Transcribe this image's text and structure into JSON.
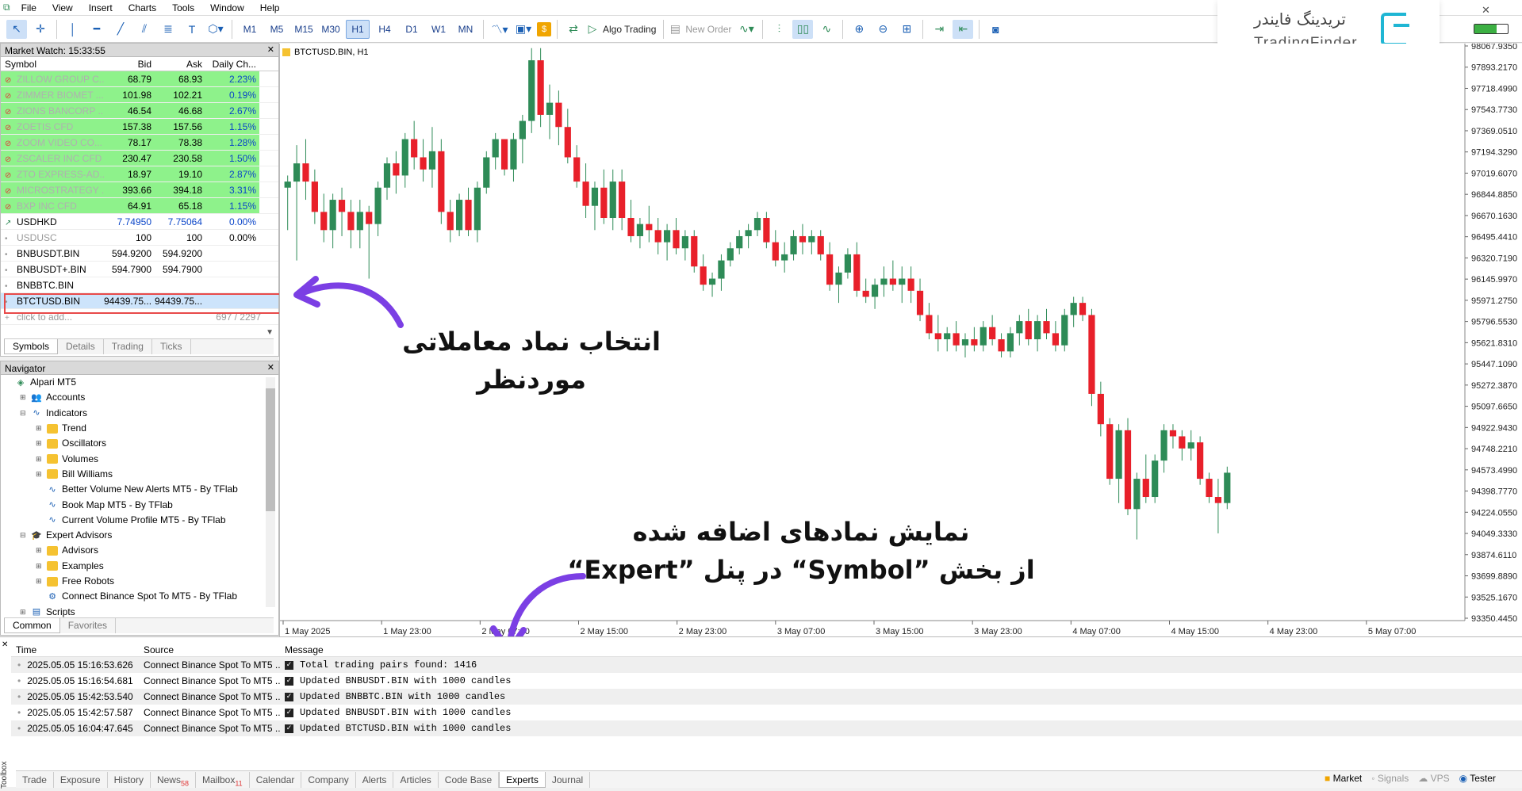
{
  "menu": [
    "File",
    "View",
    "Insert",
    "Charts",
    "Tools",
    "Window",
    "Help"
  ],
  "toolbar": {
    "timeframes": [
      "M1",
      "M5",
      "M15",
      "M30",
      "H1",
      "H4",
      "D1",
      "W1",
      "MN"
    ],
    "active_timeframe": "H1",
    "algo_trading": "Algo Trading",
    "new_order": "New Order"
  },
  "logo": {
    "farsi": "تریدینگ فایندر",
    "latin": "TradingFinder"
  },
  "market_watch": {
    "title": "Market Watch: 15:33:55",
    "headers": [
      "Symbol",
      "Bid",
      "Ask",
      "Daily Ch..."
    ],
    "rows": [
      {
        "symbol": "ZILLOW GROUP C...",
        "bid": "68.79",
        "ask": "68.93",
        "change": "2.23%",
        "style": "green",
        "dot": "red"
      },
      {
        "symbol": "ZIMMER BIOMET ...",
        "bid": "101.98",
        "ask": "102.21",
        "change": "0.19%",
        "style": "green",
        "dot": "red"
      },
      {
        "symbol": "ZIONS BANCORP ...",
        "bid": "46.54",
        "ask": "46.68",
        "change": "2.67%",
        "style": "green",
        "dot": "red"
      },
      {
        "symbol": "ZOETIS CFD",
        "bid": "157.38",
        "ask": "157.56",
        "change": "1.15%",
        "style": "green",
        "dot": "red"
      },
      {
        "symbol": "ZOOM VIDEO CO...",
        "bid": "78.17",
        "ask": "78.38",
        "change": "1.28%",
        "style": "green",
        "dot": "red"
      },
      {
        "symbol": "ZSCALER INC CFD",
        "bid": "230.47",
        "ask": "230.58",
        "change": "1.50%",
        "style": "green",
        "dot": "red"
      },
      {
        "symbol": "ZTO EXPRESS-AD...",
        "bid": "18.97",
        "ask": "19.10",
        "change": "2.87%",
        "style": "green",
        "dot": "red"
      },
      {
        "symbol": "MICROSTRATEGY ...",
        "bid": "393.66",
        "ask": "394.18",
        "change": "3.31%",
        "style": "green",
        "dot": "red"
      },
      {
        "symbol": "BXP INC CFD",
        "bid": "64.91",
        "ask": "65.18",
        "change": "1.15%",
        "style": "green",
        "dot": "red"
      },
      {
        "symbol": "USDHKD",
        "bid": "7.74950",
        "ask": "7.75064",
        "change": "0.00%",
        "style": "blue",
        "dot": "grn"
      },
      {
        "symbol": "USDUSC",
        "bid": "100",
        "ask": "100",
        "change": "0.00%",
        "style": "dim",
        "dot": "gray"
      },
      {
        "symbol": "BNBUSDT.BIN",
        "bid": "594.9200",
        "ask": "594.9200",
        "change": "",
        "style": "",
        "dot": "gray"
      },
      {
        "symbol": "BNBUSDT+.BIN",
        "bid": "594.7900",
        "ask": "594.7900",
        "change": "",
        "style": "",
        "dot": "gray"
      },
      {
        "symbol": "BNBBTC.BIN",
        "bid": "",
        "ask": "",
        "change": "",
        "style": "",
        "dot": "gray"
      },
      {
        "symbol": "BTCTUSD.BIN",
        "bid": "94439.75...",
        "ask": "94439.75...",
        "change": "",
        "style": "sel",
        "dot": "gray"
      }
    ],
    "add_placeholder": "click to add...",
    "count": "697 / 2297",
    "tabs": [
      "Symbols",
      "Details",
      "Trading",
      "Ticks"
    ]
  },
  "navigator": {
    "title": "Navigator",
    "items": [
      {
        "label": "Alpari MT5",
        "level": 0,
        "icon": "broker-icon",
        "pm": ""
      },
      {
        "label": "Accounts",
        "level": 1,
        "icon": "accounts-icon",
        "pm": "+"
      },
      {
        "label": "Indicators",
        "level": 1,
        "icon": "indicators-icon",
        "pm": "-"
      },
      {
        "label": "Trend",
        "level": 2,
        "icon": "folder-icon",
        "pm": "+"
      },
      {
        "label": "Oscillators",
        "level": 2,
        "icon": "folder-icon",
        "pm": "+"
      },
      {
        "label": "Volumes",
        "level": 2,
        "icon": "folder-icon",
        "pm": "+"
      },
      {
        "label": "Bill Williams",
        "level": 2,
        "icon": "folder-icon",
        "pm": "+"
      },
      {
        "label": "Better Volume New Alerts MT5 - By TFlab",
        "level": 2,
        "icon": "indicator-icon",
        "pm": ""
      },
      {
        "label": "Book Map MT5 - By TFlab",
        "level": 2,
        "icon": "indicator-icon",
        "pm": ""
      },
      {
        "label": "Current Volume Profile MT5 - By TFlab",
        "level": 2,
        "icon": "indicator-icon",
        "pm": ""
      },
      {
        "label": "Expert Advisors",
        "level": 1,
        "icon": "experts-icon",
        "pm": "-"
      },
      {
        "label": "Advisors",
        "level": 2,
        "icon": "folder-icon",
        "pm": "+"
      },
      {
        "label": "Examples",
        "level": 2,
        "icon": "folder-icon",
        "pm": "+"
      },
      {
        "label": "Free Robots",
        "level": 2,
        "icon": "folder-icon",
        "pm": "+"
      },
      {
        "label": "Connect Binance Spot To MT5 - By TFlab",
        "level": 2,
        "icon": "expert-icon",
        "pm": ""
      },
      {
        "label": "Scripts",
        "level": 1,
        "icon": "scripts-icon",
        "pm": "+"
      }
    ],
    "tabs": [
      "Common",
      "Favorites"
    ]
  },
  "chart": {
    "title": "BTCTUSD.BIN, H1",
    "price_labels": [
      "98067.9350",
      "97893.2170",
      "97718.4990",
      "97543.7730",
      "97369.0510",
      "97194.3290",
      "97019.6070",
      "96844.8850",
      "96670.1630",
      "96495.4410",
      "96320.7190",
      "96145.9970",
      "95971.2750",
      "95796.5530",
      "95621.8310",
      "95447.1090",
      "95272.3870",
      "95097.6650",
      "94922.9430",
      "94748.2210",
      "94573.4990",
      "94398.7770",
      "94224.0550",
      "94049.3330",
      "93874.6110",
      "93699.8890",
      "93525.1670",
      "93350.4450"
    ],
    "time_labels": [
      "1 May 2025",
      "1 May 23:00",
      "2 May 07:00",
      "2 May 15:00",
      "2 May 23:00",
      "3 May 07:00",
      "3 May 15:00",
      "3 May 23:00",
      "4 May 07:00",
      "4 May 15:00",
      "4 May 23:00",
      "5 May 07:00"
    ],
    "colors": {
      "bull": "#2e8b57",
      "bear": "#e8202a",
      "wick": "#2e8b57"
    }
  },
  "chart_data": {
    "type": "candlestick",
    "title": "BTCTUSD.BIN, H1",
    "y_min": 93350.445,
    "y_max": 98067.935,
    "candles": [
      [
        96900,
        97000,
        96550,
        96950
      ],
      [
        96950,
        97250,
        96300,
        97100
      ],
      [
        97100,
        97300,
        96800,
        96950
      ],
      [
        96950,
        97050,
        96600,
        96700
      ],
      [
        96700,
        96850,
        96450,
        96550
      ],
      [
        96550,
        96850,
        96400,
        96800
      ],
      [
        96800,
        96900,
        96500,
        96700
      ],
      [
        96700,
        96800,
        96400,
        96550
      ],
      [
        96550,
        96800,
        96400,
        96700
      ],
      [
        96700,
        96750,
        96150,
        96600
      ],
      [
        96600,
        96950,
        96500,
        96900
      ],
      [
        96900,
        97150,
        96800,
        97100
      ],
      [
        97100,
        97200,
        96850,
        97000
      ],
      [
        97000,
        97350,
        96900,
        97300
      ],
      [
        97300,
        97450,
        97050,
        97150
      ],
      [
        97150,
        97300,
        96950,
        97050
      ],
      [
        97050,
        97400,
        96900,
        97200
      ],
      [
        97200,
        97300,
        96600,
        96700
      ],
      [
        96700,
        96800,
        96450,
        96550
      ],
      [
        96550,
        96850,
        96500,
        96800
      ],
      [
        96800,
        96900,
        96500,
        96550
      ],
      [
        96550,
        96950,
        96450,
        96900
      ],
      [
        96900,
        97200,
        96850,
        97150
      ],
      [
        97150,
        97350,
        97050,
        97300
      ],
      [
        97300,
        97300,
        97000,
        97050
      ],
      [
        97050,
        97350,
        96950,
        97300
      ],
      [
        97300,
        97500,
        97100,
        97450
      ],
      [
        97450,
        98050,
        97350,
        97950
      ],
      [
        97950,
        98050,
        97400,
        97500
      ],
      [
        97500,
        97750,
        97300,
        97600
      ],
      [
        97600,
        97700,
        97250,
        97400
      ],
      [
        97400,
        97550,
        97100,
        97150
      ],
      [
        97150,
        97250,
        96900,
        96950
      ],
      [
        96950,
        97100,
        96650,
        96750
      ],
      [
        96750,
        96950,
        96550,
        96900
      ],
      [
        96900,
        97050,
        96600,
        96650
      ],
      [
        96650,
        97050,
        96550,
        96950
      ],
      [
        96950,
        97050,
        96550,
        96650
      ],
      [
        96650,
        96800,
        96450,
        96500
      ],
      [
        96500,
        96650,
        96400,
        96600
      ],
      [
        96600,
        96750,
        96450,
        96550
      ],
      [
        96550,
        96650,
        96350,
        96450
      ],
      [
        96450,
        96600,
        96300,
        96550
      ],
      [
        96550,
        96650,
        96350,
        96400
      ],
      [
        96400,
        96550,
        96300,
        96500
      ],
      [
        96500,
        96550,
        96200,
        96250
      ],
      [
        96250,
        96350,
        96050,
        96100
      ],
      [
        96100,
        96200,
        96000,
        96150
      ],
      [
        96150,
        96350,
        96050,
        96300
      ],
      [
        96300,
        96450,
        96250,
        96400
      ],
      [
        96400,
        96550,
        96350,
        96500
      ],
      [
        96500,
        96600,
        96400,
        96550
      ],
      [
        96550,
        96700,
        96500,
        96650
      ],
      [
        96650,
        96700,
        96400,
        96450
      ],
      [
        96450,
        96550,
        96250,
        96300
      ],
      [
        96300,
        96450,
        96200,
        96350
      ],
      [
        96350,
        96550,
        96300,
        96500
      ],
      [
        96500,
        96600,
        96350,
        96450
      ],
      [
        96450,
        96550,
        96350,
        96500
      ],
      [
        96500,
        96550,
        96300,
        96350
      ],
      [
        96350,
        96450,
        96050,
        96100
      ],
      [
        96100,
        96250,
        95950,
        96200
      ],
      [
        96200,
        96400,
        96150,
        96350
      ],
      [
        96350,
        96450,
        96000,
        96050
      ],
      [
        96050,
        96150,
        95950,
        96000
      ],
      [
        96000,
        96150,
        95900,
        96100
      ],
      [
        96100,
        96250,
        96000,
        96150
      ],
      [
        96150,
        96300,
        96050,
        96100
      ],
      [
        96100,
        96250,
        95950,
        96150
      ],
      [
        96150,
        96250,
        95950,
        96050
      ],
      [
        96050,
        96150,
        95800,
        95850
      ],
      [
        95850,
        95950,
        95650,
        95700
      ],
      [
        95700,
        95850,
        95550,
        95650
      ],
      [
        95650,
        95750,
        95550,
        95700
      ],
      [
        95700,
        95800,
        95550,
        95600
      ],
      [
        95600,
        95700,
        95500,
        95650
      ],
      [
        95650,
        95750,
        95550,
        95600
      ],
      [
        95600,
        95800,
        95550,
        95750
      ],
      [
        95750,
        95850,
        95600,
        95650
      ],
      [
        95650,
        95700,
        95500,
        95550
      ],
      [
        95550,
        95750,
        95500,
        95700
      ],
      [
        95700,
        95850,
        95600,
        95800
      ],
      [
        95800,
        95900,
        95600,
        95650
      ],
      [
        95650,
        95850,
        95550,
        95800
      ],
      [
        95800,
        95900,
        95650,
        95700
      ],
      [
        95700,
        95800,
        95550,
        95600
      ],
      [
        95600,
        95900,
        95550,
        95850
      ],
      [
        95850,
        96000,
        95750,
        95950
      ],
      [
        95950,
        96000,
        95800,
        95850
      ],
      [
        95850,
        95900,
        95100,
        95200
      ],
      [
        95200,
        95300,
        94850,
        94950
      ],
      [
        94950,
        95000,
        94450,
        94500
      ],
      [
        94500,
        94950,
        94300,
        94900
      ],
      [
        94900,
        95000,
        94200,
        94250
      ],
      [
        94250,
        94550,
        94000,
        94500
      ],
      [
        94500,
        94700,
        94300,
        94350
      ],
      [
        94350,
        94700,
        94300,
        94650
      ],
      [
        94650,
        94950,
        94550,
        94900
      ],
      [
        94900,
        94950,
        94750,
        94850
      ],
      [
        94850,
        94900,
        94650,
        94750
      ],
      [
        94750,
        94900,
        94650,
        94800
      ],
      [
        94800,
        94850,
        94450,
        94500
      ],
      [
        94500,
        94550,
        94300,
        94350
      ],
      [
        94350,
        94500,
        94050,
        94300
      ],
      [
        94300,
        94600,
        94250,
        94550
      ]
    ],
    "ylabel": "",
    "xlabel": ""
  },
  "annotations": {
    "top": [
      "انتخاب نماد معاملاتی",
      "موردنظر"
    ],
    "bottom": [
      "نمایش نمادهای اضافه شده",
      "از بخش ”Symbol“ در پنل ”Expert“"
    ]
  },
  "toolbox": {
    "headers": [
      "Time",
      "Source",
      "Message"
    ],
    "rows": [
      {
        "time": "2025.05.05 15:16:53.626",
        "source": "Connect Binance Spot To MT5 ...",
        "message": "Total trading pairs found: 1416"
      },
      {
        "time": "2025.05.05 15:16:54.681",
        "source": "Connect Binance Spot To MT5 ...",
        "message": "Updated BNBUSDT.BIN with 1000 candles"
      },
      {
        "time": "2025.05.05 15:42:53.540",
        "source": "Connect Binance Spot To MT5 ...",
        "message": "Updated BNBBTC.BIN with 1000 candles"
      },
      {
        "time": "2025.05.05 15:42:57.587",
        "source": "Connect Binance Spot To MT5 ...",
        "message": "Updated BNBUSDT.BIN with 1000 candles"
      },
      {
        "time": "2025.05.05 16:04:47.645",
        "source": "Connect Binance Spot To MT5 ...",
        "message": "Updated BTCTUSD.BIN with 1000 candles"
      }
    ],
    "tabs": [
      {
        "label": "Trade",
        "badge": ""
      },
      {
        "label": "Exposure",
        "badge": ""
      },
      {
        "label": "History",
        "badge": ""
      },
      {
        "label": "News",
        "badge": "58"
      },
      {
        "label": "Mailbox",
        "badge": "11"
      },
      {
        "label": "Calendar",
        "badge": ""
      },
      {
        "label": "Company",
        "badge": ""
      },
      {
        "label": "Alerts",
        "badge": ""
      },
      {
        "label": "Articles",
        "badge": ""
      },
      {
        "label": "Code Base",
        "badge": ""
      },
      {
        "label": "Experts",
        "badge": ""
      },
      {
        "label": "Journal",
        "badge": ""
      }
    ],
    "active_tab": "Experts",
    "side_label": "Toolbox",
    "right": [
      "Market",
      "Signals",
      "VPS",
      "Tester"
    ]
  }
}
